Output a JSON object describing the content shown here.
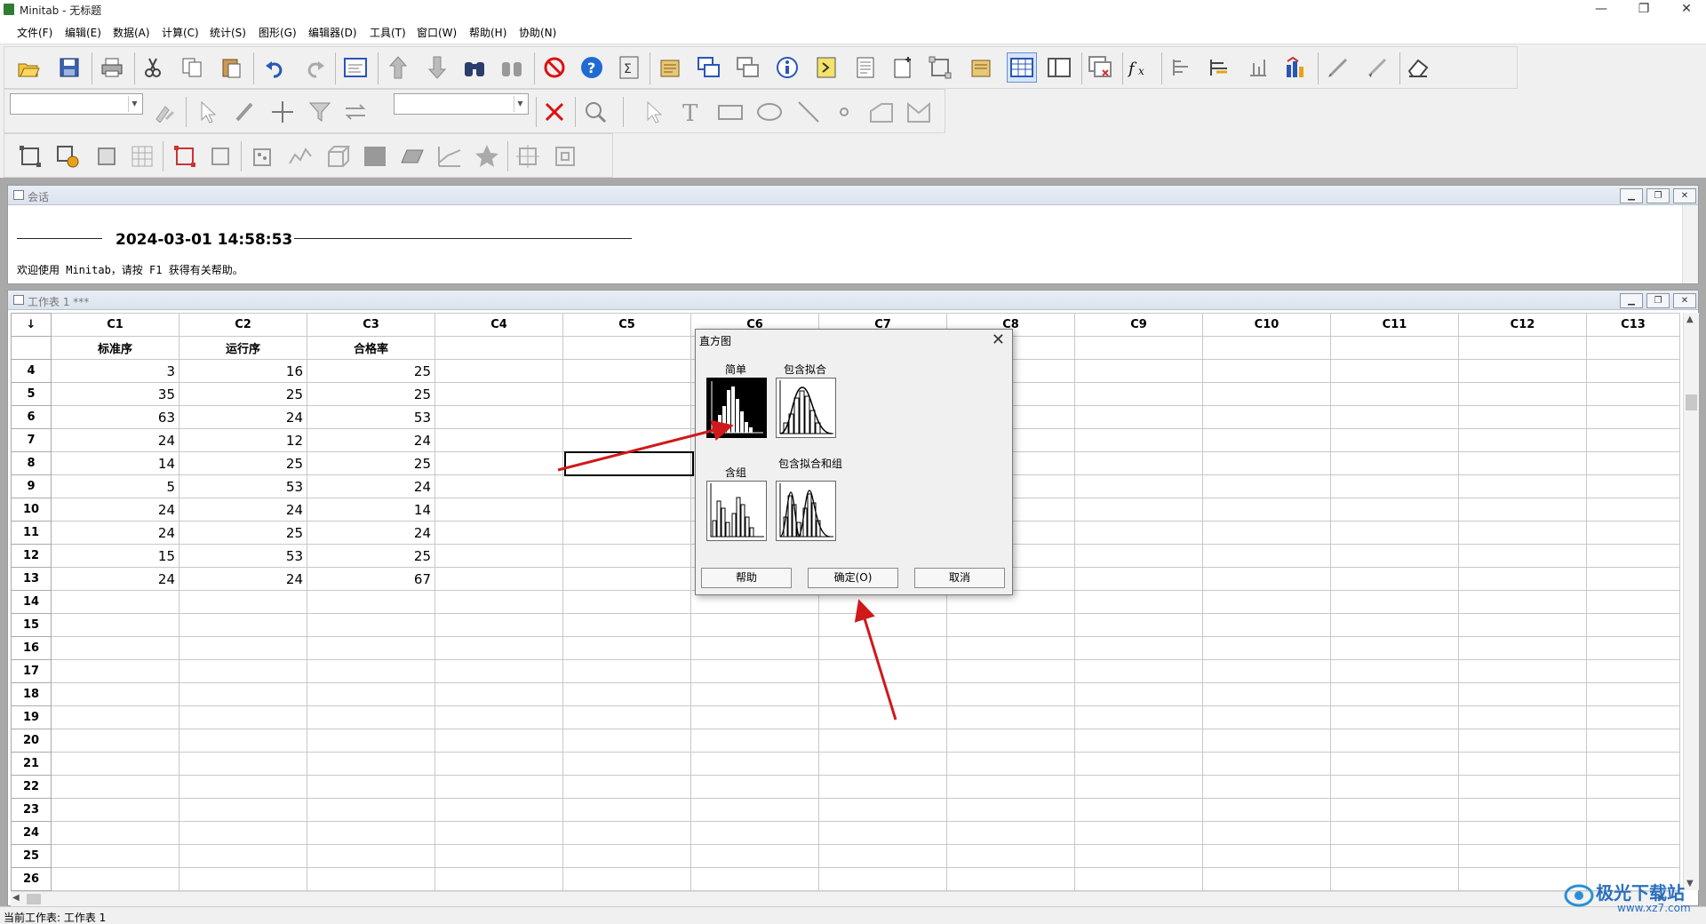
{
  "app": {
    "title": "Minitab - 无标题"
  },
  "menu": [
    "文件(F)",
    "编辑(E)",
    "数据(A)",
    "计算(C)",
    "统计(S)",
    "图形(G)",
    "编辑器(D)",
    "工具(T)",
    "窗口(W)",
    "帮助(H)",
    "协助(N)"
  ],
  "session": {
    "title": "会话",
    "timestamp": "2024-03-01 14:58:53",
    "welcome": "欢迎使用 Minitab，请按 F1 获得有关帮助。"
  },
  "worksheet": {
    "title": "工作表 1 ***",
    "arrow_header": "↓",
    "columns": [
      "C1",
      "C2",
      "C3",
      "C4",
      "C5",
      "C6",
      "C7",
      "C8",
      "C9",
      "C10",
      "C11",
      "C12",
      "C13"
    ],
    "column_names": [
      "标准序",
      "运行序",
      "合格率",
      "",
      "",
      "",
      "",
      "",
      "",
      "",
      "",
      "",
      ""
    ],
    "rows": [
      {
        "n": "4",
        "c1": "3",
        "c2": "16",
        "c3": "25"
      },
      {
        "n": "5",
        "c1": "35",
        "c2": "25",
        "c3": "25"
      },
      {
        "n": "6",
        "c1": "63",
        "c2": "24",
        "c3": "53"
      },
      {
        "n": "7",
        "c1": "24",
        "c2": "12",
        "c3": "24"
      },
      {
        "n": "8",
        "c1": "14",
        "c2": "25",
        "c3": "25"
      },
      {
        "n": "9",
        "c1": "5",
        "c2": "53",
        "c3": "24"
      },
      {
        "n": "10",
        "c1": "24",
        "c2": "24",
        "c3": "14"
      },
      {
        "n": "11",
        "c1": "24",
        "c2": "25",
        "c3": "24"
      },
      {
        "n": "12",
        "c1": "15",
        "c2": "53",
        "c3": "25"
      },
      {
        "n": "13",
        "c1": "24",
        "c2": "24",
        "c3": "67"
      },
      {
        "n": "14",
        "c1": "",
        "c2": "",
        "c3": ""
      },
      {
        "n": "15",
        "c1": "",
        "c2": "",
        "c3": ""
      },
      {
        "n": "16",
        "c1": "",
        "c2": "",
        "c3": ""
      },
      {
        "n": "17",
        "c1": "",
        "c2": "",
        "c3": ""
      },
      {
        "n": "18",
        "c1": "",
        "c2": "",
        "c3": ""
      },
      {
        "n": "19",
        "c1": "",
        "c2": "",
        "c3": ""
      },
      {
        "n": "20",
        "c1": "",
        "c2": "",
        "c3": ""
      },
      {
        "n": "21",
        "c1": "",
        "c2": "",
        "c3": ""
      },
      {
        "n": "22",
        "c1": "",
        "c2": "",
        "c3": ""
      },
      {
        "n": "23",
        "c1": "",
        "c2": "",
        "c3": ""
      },
      {
        "n": "24",
        "c1": "",
        "c2": "",
        "c3": ""
      },
      {
        "n": "25",
        "c1": "",
        "c2": "",
        "c3": ""
      },
      {
        "n": "26",
        "c1": "",
        "c2": "",
        "c3": ""
      }
    ]
  },
  "dialog": {
    "title": "直方图",
    "options": [
      {
        "label": "简单",
        "selected": true
      },
      {
        "label": "包含拟合",
        "selected": false
      },
      {
        "label": "含组",
        "selected": false
      },
      {
        "label": "包含拟合和组",
        "selected": false
      }
    ],
    "buttons": {
      "help": "帮助",
      "ok": "确定(O)",
      "cancel": "取消"
    }
  },
  "status": {
    "text": "当前工作表: 工作表 1"
  },
  "watermark": {
    "text": "极光下载站",
    "url_text": "www.xz7.com"
  },
  "colors": {
    "annotation_arrow": "#d0191b",
    "selection": "#000000"
  }
}
